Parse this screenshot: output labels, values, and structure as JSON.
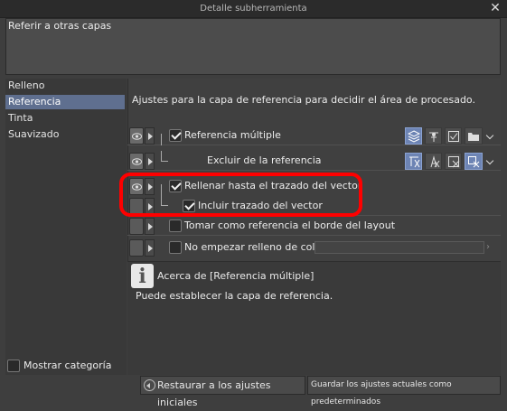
{
  "window": {
    "title": "Detalle subherramienta"
  },
  "name_field": {
    "value": "Referir a otras capas"
  },
  "sidebar": {
    "items": [
      {
        "label": "Relleno"
      },
      {
        "label": "Referencia"
      },
      {
        "label": "Tinta"
      },
      {
        "label": "Suavizado"
      }
    ],
    "selected": "Referencia",
    "show_category_label": "Mostrar categoría"
  },
  "main": {
    "description": "Ajustes para la capa de referencia para decidir el área de procesado.",
    "rows": [
      {
        "label": "Referencia múltiple",
        "checked": true
      },
      {
        "label": "Excluir de la referencia"
      },
      {
        "label": "Rellenar hasta el trazado del vector",
        "checked": true
      },
      {
        "label": "Incluir trazado del vector",
        "checked": true
      },
      {
        "label": "Tomar como referencia el borde del layout",
        "checked": false
      },
      {
        "label": "No empezar relleno de color",
        "checked": false
      }
    ],
    "ref_icons": [
      "all-layers-icon",
      "reference-layer-icon",
      "selected-layers-icon",
      "folder-icon"
    ],
    "exclude_icons": [
      "exclude-text-icon",
      "exclude-edit-icon",
      "exclude-paper-icon",
      "exclude-layer-icon"
    ]
  },
  "info": {
    "title": "Acerca de [Referencia múltiple]",
    "text": "Puede establecer la capa de referencia."
  },
  "footer": {
    "restore_label": "Restaurar a los ajustes iniciales",
    "save_label": "Guardar los ajustes actuales como predeterminados"
  },
  "colors": {
    "selection": "#5f6f8f",
    "highlight": "#ff0000",
    "icon_active": "#6d84b4"
  }
}
